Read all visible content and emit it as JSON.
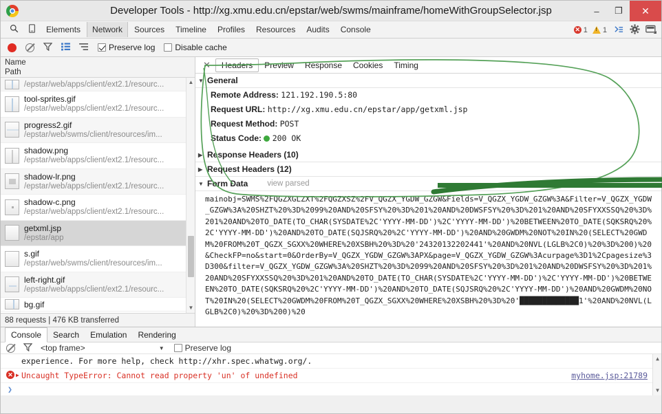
{
  "window": {
    "title": "Developer Tools - http://xg.xmu.edu.cn/epstar/web/swms/mainframe/homeWithGroupSelector.jsp",
    "minimize": "–",
    "maximize": "❐",
    "close": "✕"
  },
  "devtools": {
    "search_icon": "⚲",
    "device_icon": "▢",
    "tabs": [
      {
        "label": "Elements",
        "active": false
      },
      {
        "label": "Network",
        "active": true
      },
      {
        "label": "Sources",
        "active": false
      },
      {
        "label": "Timeline",
        "active": false
      },
      {
        "label": "Profiles",
        "active": false
      },
      {
        "label": "Resources",
        "active": false
      },
      {
        "label": "Audits",
        "active": false
      },
      {
        "label": "Console",
        "active": false
      }
    ],
    "error_count": "1",
    "warning_count": "1",
    "error_badge": "✕",
    "console_icon": "≫",
    "gear_icon": "⚙",
    "dock_icon": "▭"
  },
  "network_toolbar": {
    "record_label": "record",
    "clear_label": "clear",
    "filter_label": "filter",
    "list_label": "list-view",
    "small_rows_label": "small-rows",
    "preserve_log": "Preserve log",
    "preserve_log_checked": true,
    "disable_cache": "Disable cache",
    "disable_cache_checked": false
  },
  "requests": {
    "header_name": "Name",
    "header_path": "Path",
    "items": [
      {
        "name": "",
        "path": "/epstar/web/apps/client/ext2.1/resourc...",
        "selected": false,
        "partial": true
      },
      {
        "name": "tool-sprites.gif",
        "path": "/epstar/web/apps/client/ext2.1/resourc...",
        "selected": false
      },
      {
        "name": "progress2.gif",
        "path": "/epstar/web/swms/client/resources/im...",
        "selected": false
      },
      {
        "name": "shadow.png",
        "path": "/epstar/web/apps/client/ext2.1/resourc...",
        "selected": false
      },
      {
        "name": "shadow-lr.png",
        "path": "/epstar/web/apps/client/ext2.1/resourc...",
        "selected": false
      },
      {
        "name": "shadow-c.png",
        "path": "/epstar/web/apps/client/ext2.1/resourc...",
        "selected": false
      },
      {
        "name": "getxml.jsp",
        "path": "/epstar/app",
        "selected": true
      },
      {
        "name": "s.gif",
        "path": "/epstar/web/swms/client/resources/im...",
        "selected": false
      },
      {
        "name": "left-right.gif",
        "path": "/epstar/web/apps/client/ext2.1/resourc...",
        "selected": false
      },
      {
        "name": "bg.gif",
        "path": "",
        "selected": false,
        "partial": true
      }
    ],
    "summary": "88 requests  |  476 KB transferred",
    "scroll_up": "▲",
    "scroll_down": "▼"
  },
  "details": {
    "close_label": "✕",
    "tabs": [
      {
        "label": "Headers",
        "active": true
      },
      {
        "label": "Preview",
        "active": false
      },
      {
        "label": "Response",
        "active": false
      },
      {
        "label": "Cookies",
        "active": false
      },
      {
        "label": "Timing",
        "active": false
      }
    ],
    "general": {
      "title": "General",
      "expanded": true,
      "remote_address_key": "Remote Address:",
      "remote_address_value": "121.192.190.5:80",
      "request_url_key": "Request URL:",
      "request_url_value": "http://xg.xmu.edu.cn/epstar/app/getxml.jsp",
      "request_method_key": "Request Method:",
      "request_method_value": "POST",
      "status_code_key": "Status Code:",
      "status_code_value": "200  OK",
      "status_color": "#3ea93e"
    },
    "response_headers": {
      "title": "Response Headers (10)",
      "expanded": false
    },
    "request_headers": {
      "title": "Request Headers (12)",
      "expanded": false
    },
    "form_data": {
      "title": "Form Data",
      "view_parsed": "view parsed",
      "expanded": true,
      "body": "mainobj=SWMS%2FQGZXGLZXT%2FQGZXSZ%2FV_QGZX_YGDW_GZGW&Fields=V_QGZX_YGDW_GZGW%3A&Filter=V_QGZX_YGDW_GZGW%3A%20SHZT%20%3D%2099%20AND%20SFSY%20%3D%201%20AND%20DWSFSY%20%3D%201%20AND%20SFYXXSSQ%20%3D%201%20AND%20TO_DATE(TO_CHAR(SYSDATE%2C'YYYY-MM-DD')%2C'YYYY-MM-DD')%20BETWEEN%20TO_DATE(SQKSRQ%20%2C'YYYY-MM-DD')%20AND%20TO_DATE(SQJSRQ%20%2C'YYYY-MM-DD')%20AND%20GWDM%20NOT%20IN%20(SELECT%20GWDM%20FROM%20T_QGZX_SGXX%20WHERE%20XSBH%20%3D%20'24320132202441'%20AND%20NVL(LGLB%2C0)%20%3D%200)%20&CheckFP=no&start=0&OrderBy=V_QGZX_YGDW_GZGW%3APX&page=V_QGZX_YGDW_GZGW%3Acurpage%3D1%2Cpagesize%3D300&filter=V_QGZX_YGDW_GZGW%3A%20SHZT%20%3D%2099%20AND%20SFSY%20%3D%201%20AND%20DWSFSY%20%3D%201%20AND%20SFYXXSSQ%20%3D%201%20AND%20TO_DATE(TO_CHAR(SYSDATE%2C'YYYY-MM-DD')%2C'YYYY-MM-DD')%20BETWEEN%20TO_DATE(SQKSRQ%20%2C'YYYY-MM-DD')%20AND%20TO_DATE(SQJSRQ%20%2C'YYYY-MM-DD')%20AND%20GWDM%20NOT%20IN%20(SELECT%20GWDM%20FROM%20T_QGZX_SGXX%20WHERE%20XSBH%20%3D%20'█████████████1'%20AND%20NVL(LGLB%2C0)%20%3D%200)%20"
    }
  },
  "drawer": {
    "tabs": [
      {
        "label": "Console",
        "active": true
      },
      {
        "label": "Search",
        "active": false
      },
      {
        "label": "Emulation",
        "active": false
      },
      {
        "label": "Rendering",
        "active": false
      }
    ],
    "clear_icon": "clear-icon",
    "filter_icon": "filter-icon",
    "frame_selector": "<top frame>",
    "caret": "▼",
    "preserve_log": "Preserve log",
    "preserve_log_checked": false,
    "lines": [
      {
        "type": "info",
        "text": "experience. For more help, check http://xhr.spec.whatwg.org/.",
        "source": ""
      },
      {
        "type": "error",
        "text": "Uncaught TypeError: Cannot read property 'un' of undefined",
        "source": "myhome.jsp:21789"
      }
    ],
    "prompt": "❯"
  },
  "colors": {
    "accent_red": "#d93025",
    "accent_green": "#3ea93e",
    "annotation_green": "#4f9d52",
    "selection_gray": "#d6d6d6"
  }
}
